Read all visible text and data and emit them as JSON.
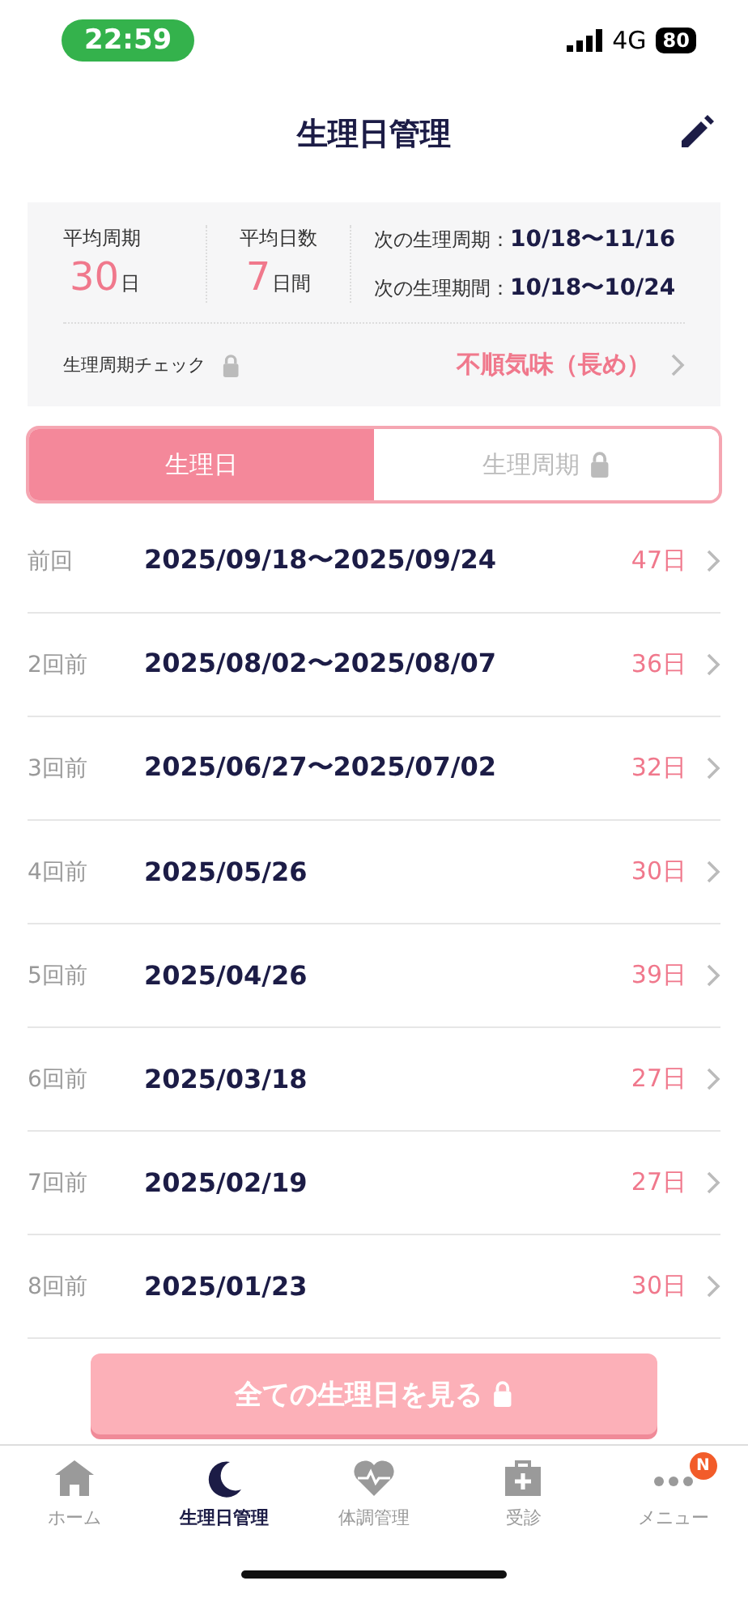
{
  "status_bar": {
    "time": "22:59",
    "network": "4G",
    "battery": "80"
  },
  "header": {
    "title": "生理日管理"
  },
  "summary": {
    "avg_cycle": {
      "label": "平均周期",
      "value": "30",
      "unit": "日"
    },
    "avg_days": {
      "label": "平均日数",
      "value": "7",
      "unit": "日間"
    },
    "next": [
      {
        "label": "次の生理周期：",
        "value": "10/18〜11/16"
      },
      {
        "label": "次の生理期間：",
        "value": "10/18〜10/24"
      }
    ],
    "check": {
      "label": "生理周期チェック",
      "result": "不順気味（長め）",
      "locked": true
    }
  },
  "tabs": [
    {
      "label": "生理日",
      "selected": true,
      "locked": false
    },
    {
      "label": "生理周期",
      "selected": false,
      "locked": true
    }
  ],
  "history": [
    {
      "label": "前回",
      "dates": "2025/09/18〜2025/09/24",
      "days": "47日"
    },
    {
      "label": "2回前",
      "dates": "2025/08/02〜2025/08/07",
      "days": "36日"
    },
    {
      "label": "3回前",
      "dates": "2025/06/27〜2025/07/02",
      "days": "32日"
    },
    {
      "label": "4回前",
      "dates": "2025/05/26",
      "days": "30日"
    },
    {
      "label": "5回前",
      "dates": "2025/04/26",
      "days": "39日"
    },
    {
      "label": "6回前",
      "dates": "2025/03/18",
      "days": "27日"
    },
    {
      "label": "7回前",
      "dates": "2025/02/19",
      "days": "27日"
    },
    {
      "label": "8回前",
      "dates": "2025/01/23",
      "days": "30日"
    }
  ],
  "view_all_button": {
    "label": "全ての生理日を見る",
    "locked": true
  },
  "bottom_nav": [
    {
      "label": "ホーム",
      "kind": "home",
      "selected": false
    },
    {
      "label": "生理日管理",
      "kind": "moon",
      "selected": true
    },
    {
      "label": "体調管理",
      "kind": "heart",
      "selected": false
    },
    {
      "label": "受診",
      "kind": "clinic",
      "selected": false
    },
    {
      "label": "メニュー",
      "kind": "more",
      "selected": false,
      "badge": "N"
    }
  ]
}
